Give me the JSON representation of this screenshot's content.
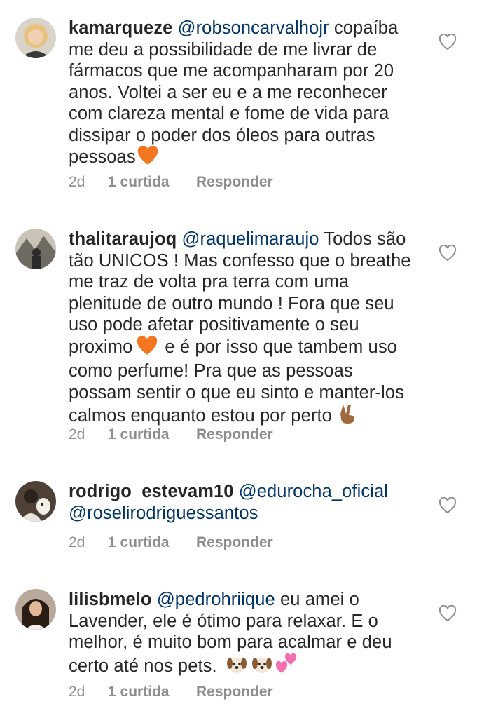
{
  "comments": [
    {
      "username": "kamarqueze",
      "mention": "@robsoncarvalhojr",
      "text": "copaíba me deu a possibilidade de me livrar de fármacos que me acompanharam por 20 anos. Voltei a ser eu e a me reconhecer com clareza mental e fome de vida para dissipar o poder dos óleos para outras pessoas",
      "emojis": [
        "orange-heart"
      ],
      "age": "2d",
      "likes": "1 curtida",
      "reply": "Responder"
    },
    {
      "username": "thalitaraujoq",
      "mention": "@raquelimaraujo",
      "text_1": "Todos são tão UNICOS ! Mas confesso que o breathe me traz de volta pra terra com uma plenitude de outro mundo ! Fora que seu uso pode afetar positivamente o seu proximo",
      "text_2": "e é por isso que tambem uso como  perfume! Pra que as pessoas possam sentir o que eu sinto e manter-los calmos enquanto estou por perto",
      "emojis": [
        "orange-heart",
        "victory-hand"
      ],
      "age": "2d",
      "likes": "1 curtida",
      "reply": "Responder"
    },
    {
      "username": "rodrigo_estevam10",
      "mention": "@edurocha_oficial",
      "mention_2": "@roselirodriguessantos",
      "age": "2d",
      "likes": "1 curtida",
      "reply": "Responder"
    },
    {
      "username": "lilisbmelo",
      "mention": "@pedrohriique",
      "text": "eu amei o Lavender, ele é ótimo para relaxar. E o melhor, é muito bom para acalmar e deu certo até nos pets.",
      "emojis": [
        "dog-face",
        "dog-face",
        "two-hearts"
      ],
      "age": "2d",
      "likes": "1 curtida",
      "reply": "Responder"
    }
  ],
  "colors": {
    "text": "#262626",
    "mention": "#003569",
    "meta": "#8e8e8e"
  },
  "icons": [
    "heart-icon",
    "orange-heart-emoji",
    "victory-hand-emoji",
    "dog-face-emoji",
    "two-hearts-emoji"
  ]
}
